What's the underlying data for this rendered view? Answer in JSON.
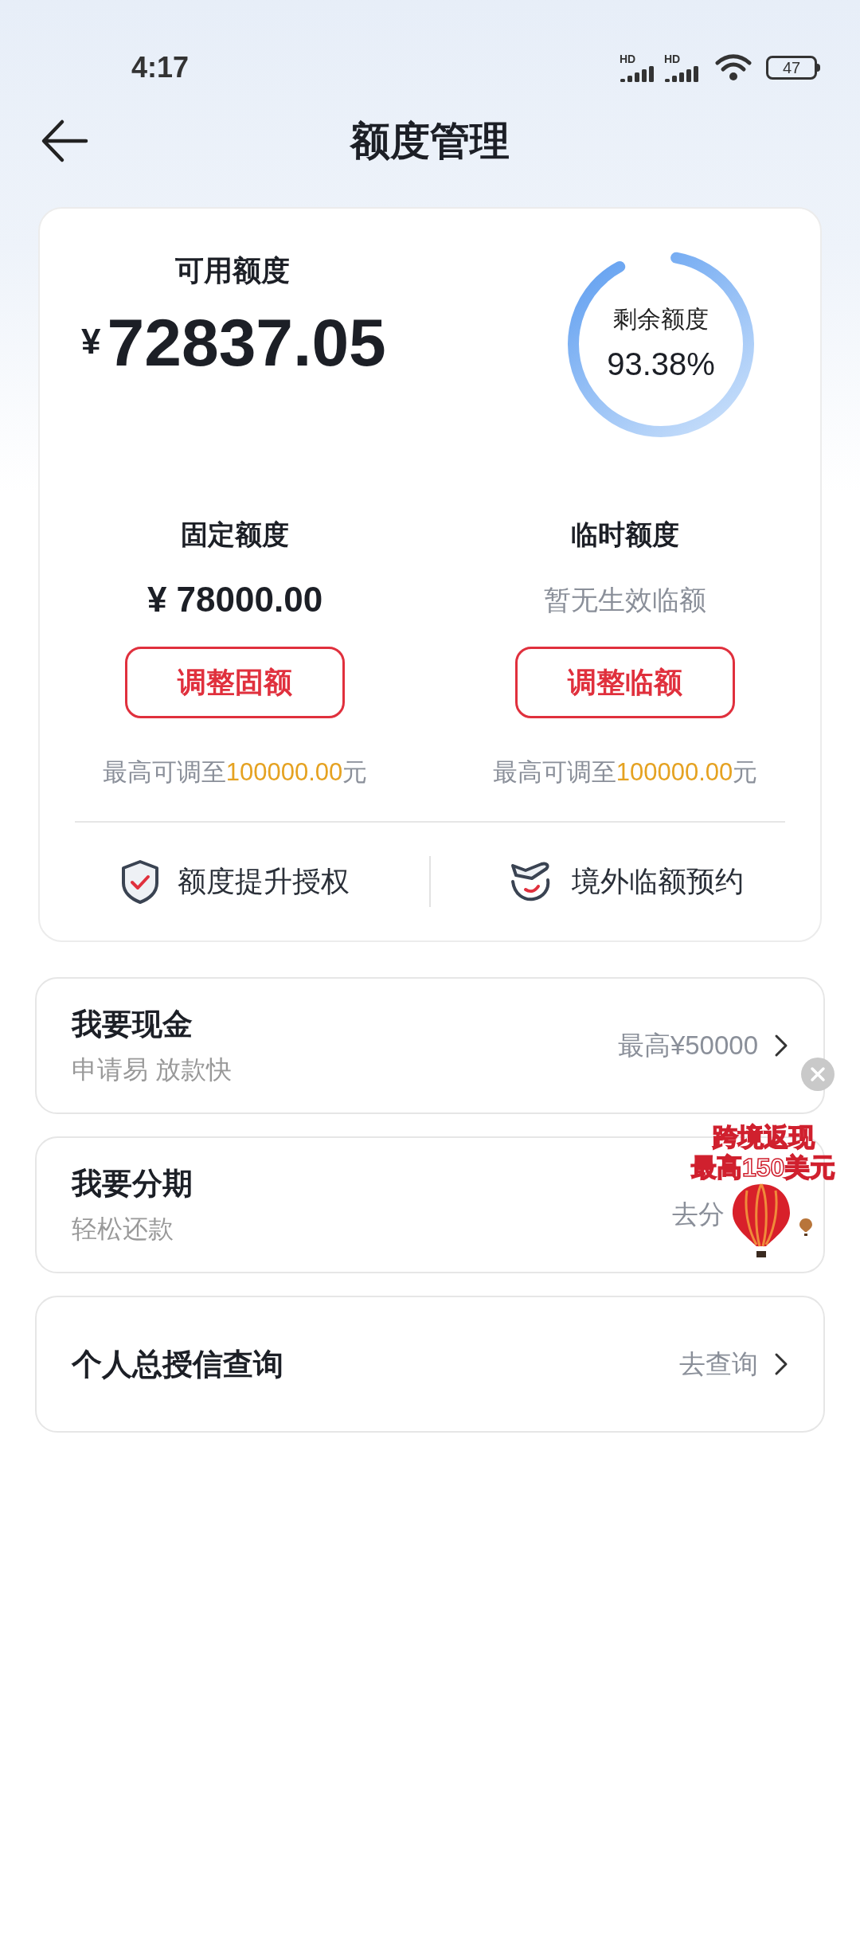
{
  "status_bar": {
    "time": "4:17",
    "signals": [
      {
        "badge": "HD"
      },
      {
        "badge": "HD"
      }
    ],
    "battery": "47"
  },
  "header": {
    "title": "额度管理"
  },
  "card": {
    "available": {
      "label": "可用额度",
      "currency": "¥",
      "amount": "72837.05"
    },
    "ring": {
      "label": "剩余额度",
      "value": "93.38%",
      "level": 0.9338
    },
    "columns": [
      {
        "title": "固定额度",
        "kind": "amount",
        "value": "¥ 78000.00",
        "button": "调整固额",
        "note": {
          "prefix": "最高可调至",
          "limit": "100000.00",
          "suffix": "元"
        }
      },
      {
        "title": "临时额度",
        "kind": "empty",
        "value": "暂无生效临额",
        "button": "调整临额",
        "note": {
          "prefix": "最高可调至",
          "limit": "100000.00",
          "suffix": "元"
        }
      }
    ],
    "links": [
      {
        "kind": "shield",
        "label": "额度提升授权"
      },
      {
        "kind": "plane",
        "label": "境外临额预约"
      }
    ]
  },
  "list": [
    {
      "title": "我要现金",
      "subtitle": "申请易 放款快",
      "action": "最高¥50000",
      "chevron": true
    },
    {
      "title": "我要分期",
      "subtitle": "轻松还款",
      "action": "去分",
      "chevron": false
    },
    {
      "title": "个人总授信查询",
      "action": "去查询",
      "chevron": true
    }
  ],
  "promo": {
    "lines": [
      "跨境返现",
      "最高150美元"
    ]
  }
}
